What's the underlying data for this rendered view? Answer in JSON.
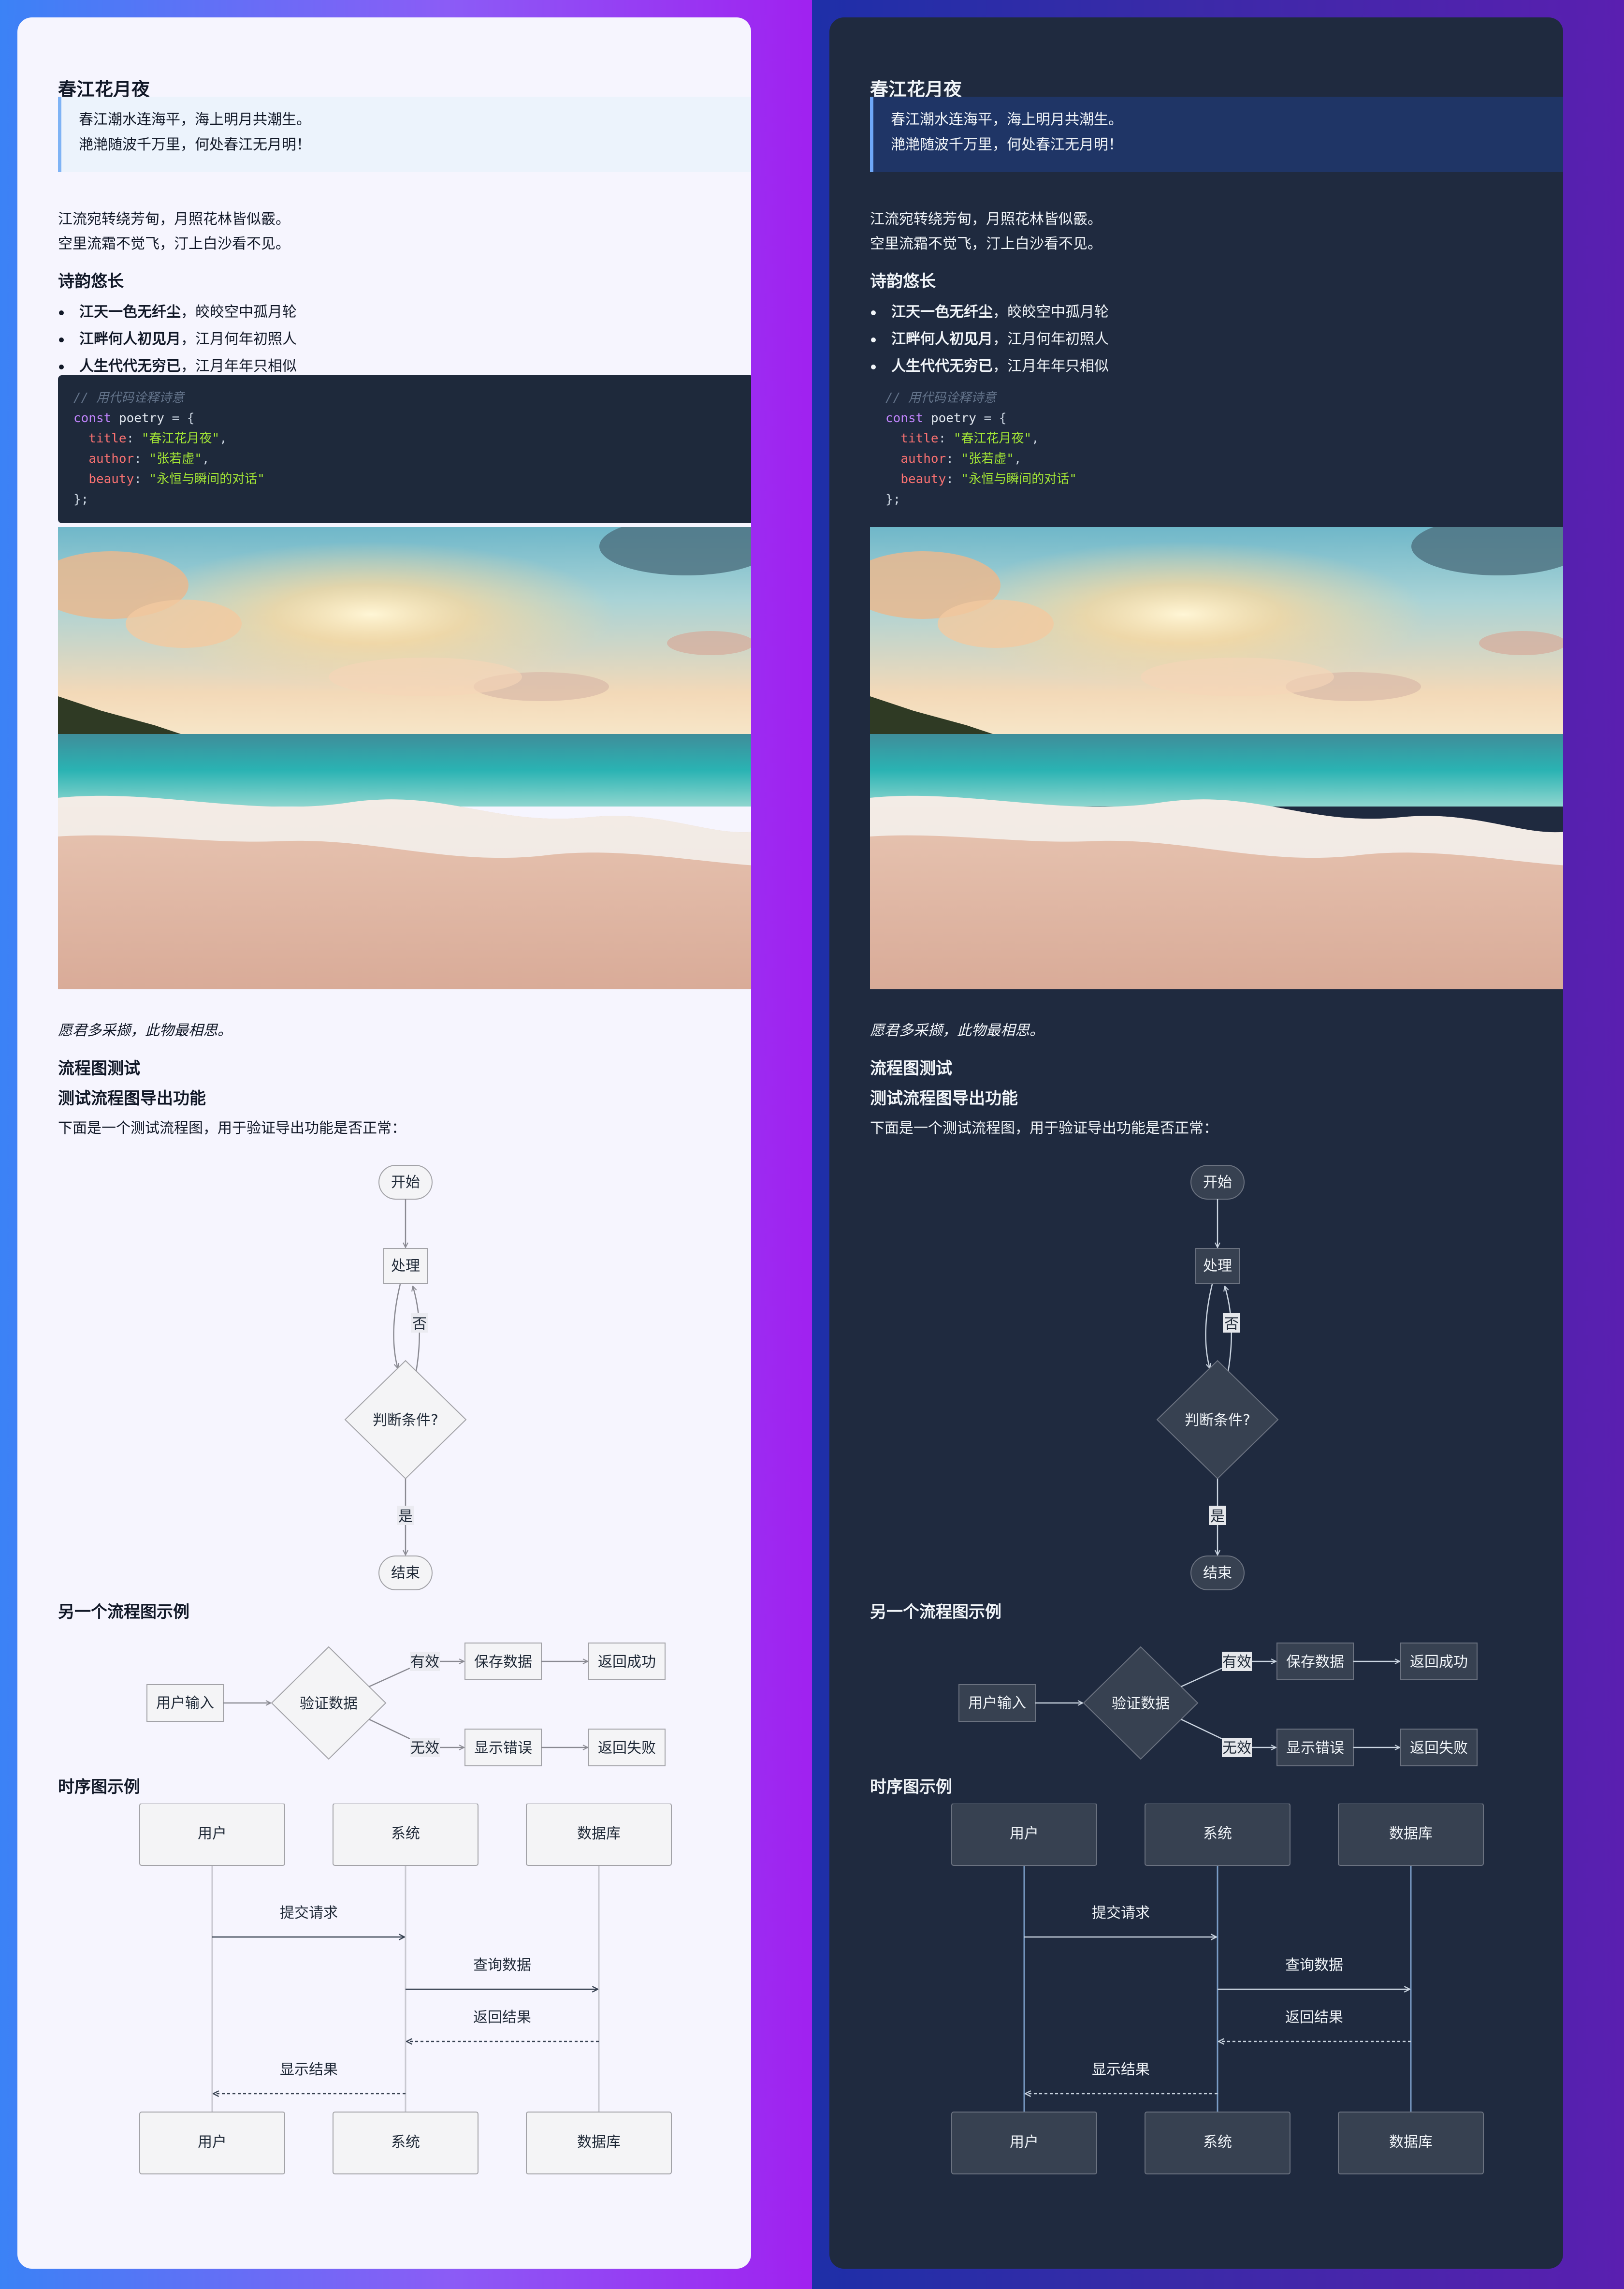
{
  "doc": {
    "title": "春江花月夜",
    "quote": [
      "春江潮水连海平，海上明月共潮生。",
      "滟滟随波千万里，何处春江无月明！"
    ],
    "paragraph": [
      "江流宛转绕芳甸，月照花林皆似霰。",
      "空里流霜不觉飞，汀上白沙看不见。"
    ],
    "section_heading": "诗韵悠长",
    "bullets": [
      {
        "bold": "江天一色无纤尘",
        "rest": "，皎皎空中孤月轮"
      },
      {
        "bold": "江畔何人初见月",
        "rest": "，江月何年初照人"
      },
      {
        "bold": "人生代代无穷已",
        "rest": "，江月年年只相似"
      }
    ],
    "code": {
      "comment": "// 用代码诠释诗意",
      "keyword": "const",
      "var_name": "poetry",
      "open": " = {",
      "close": "};",
      "fields": [
        {
          "key": "title",
          "value": "\"春江花月夜\""
        },
        {
          "key": "author",
          "value": "\"张若虚\""
        },
        {
          "key": "beauty",
          "value": "\"永恒与瞬间的对话\""
        }
      ]
    },
    "caption": "愿君多采撷，此物最相思。",
    "flow_heading": "流程图测试",
    "flow_subheading": "测试流程图导出功能",
    "flow_intro": "下面是一个测试流程图，用于验证导出功能是否正常：",
    "flow1": {
      "start": "开始",
      "process": "处理",
      "decision": "判断条件?",
      "no": "否",
      "yes": "是",
      "end": "结束"
    },
    "flow2_heading": "另一个流程图示例",
    "flow2": {
      "input": "用户输入",
      "validate": "验证数据",
      "valid": "有效",
      "invalid": "无效",
      "save": "保存数据",
      "success": "返回成功",
      "error": "显示错误",
      "fail": "返回失败"
    },
    "seq_heading": "时序图示例",
    "seq": {
      "actors": [
        "用户",
        "系统",
        "数据库"
      ],
      "messages": [
        "提交请求",
        "查询数据",
        "返回结果",
        "显示结果"
      ]
    }
  },
  "themes": {
    "light": {
      "accent": "#7fb3f5",
      "node_fill": "#f4f4f6",
      "node_stroke": "#a3a3a8",
      "line": "#8a8a92",
      "label_bg": "#ebebf1"
    },
    "dark": {
      "accent": "#6ea8f8",
      "node_fill": "#374151",
      "node_stroke": "#6b7280",
      "line": "#cbd5e1",
      "label_bg": "#e5e7eb"
    }
  }
}
